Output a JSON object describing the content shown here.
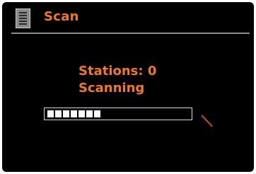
{
  "header": {
    "title": "Scan",
    "icon": "menu-list-icon"
  },
  "status": {
    "stations_text": "Stations: 0",
    "state_text": "Scanning"
  },
  "progress": {
    "fraction": 0.4
  },
  "colors": {
    "accent": "#f0782b",
    "background": "#000000",
    "divider": "#8c8c8c",
    "bar_border": "#d8d8d8",
    "bar_fill": "#ffffff",
    "activity": "#c0531a"
  }
}
